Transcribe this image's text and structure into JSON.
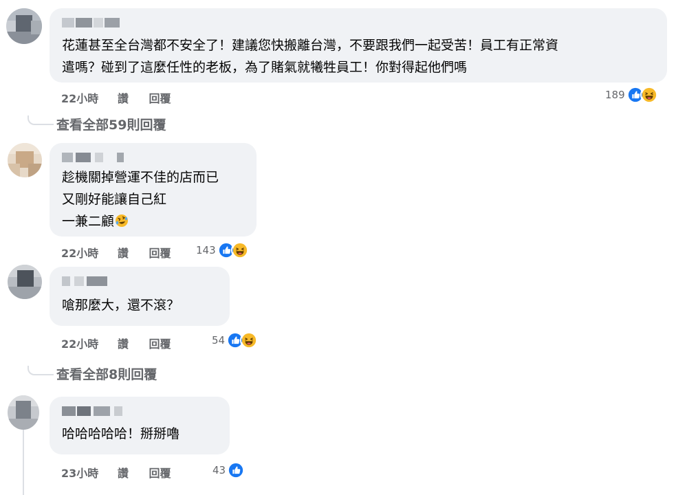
{
  "comments": [
    {
      "text": "花蓮甚至全台灣都不安全了！建議您快搬離台灣，不要跟我們一起受苦！員工有正常資\n遣嗎？碰到了這麼任性的老板，為了賭氣就犧牲員工！你對得起他們嗎",
      "time": "22小時",
      "like_label": "讚",
      "reply_label": "回覆",
      "reaction_count": "189",
      "reactions": [
        "like-icon",
        "haha-icon"
      ]
    },
    {
      "text": "趁機關掉營運不佳的店而已\n又剛好能讓自己紅\n一兼二顧",
      "inline_emoji": "rolling-laugh-emoji",
      "time": "22小時",
      "like_label": "讚",
      "reply_label": "回覆",
      "reaction_count": "143",
      "reactions": [
        "like-icon",
        "haha-icon"
      ]
    },
    {
      "text": "嗆那麼大，還不滾？",
      "time": "22小時",
      "like_label": "讚",
      "reply_label": "回覆",
      "reaction_count": "54",
      "reactions": [
        "like-icon",
        "haha-icon"
      ]
    },
    {
      "text": "哈哈哈哈哈！掰掰嚕",
      "time": "23小時",
      "like_label": "讚",
      "reply_label": "回覆",
      "reaction_count": "43",
      "reactions": [
        "like-icon"
      ]
    }
  ],
  "view_replies": [
    {
      "label": "查看全部59則回覆"
    },
    {
      "label": "查看全部8則回覆"
    }
  ],
  "colors": {
    "like_blue": "#1877f2",
    "haha_yellow": "#f7b928",
    "bubble_bg": "#f0f2f5",
    "meta_gray": "#65676b"
  }
}
